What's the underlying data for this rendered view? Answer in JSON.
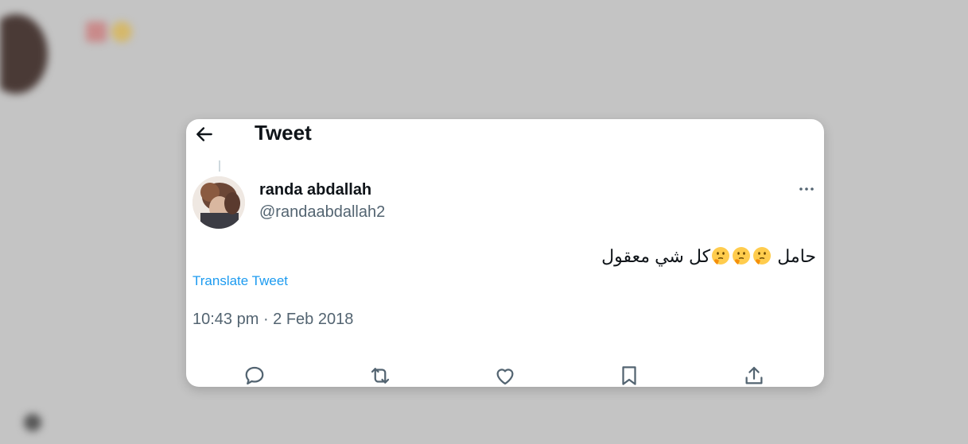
{
  "header": {
    "title": "Tweet"
  },
  "author": {
    "name": "randa abdallah",
    "handle": "@randaabdallah2"
  },
  "tweet": {
    "text_main": "حامل",
    "text_tail": "كل شي معقول",
    "emoji_icon": "thinking-face-icon",
    "translate_label": "Translate Tweet",
    "timestamp": "10:43 pm · 2 Feb 2018"
  },
  "actions": [
    "reply-icon",
    "retweet-icon",
    "like-icon",
    "bookmark-icon",
    "share-icon"
  ],
  "colors": {
    "accent": "#1d9bf0",
    "text": "#0f1419",
    "secondary": "#536471"
  }
}
